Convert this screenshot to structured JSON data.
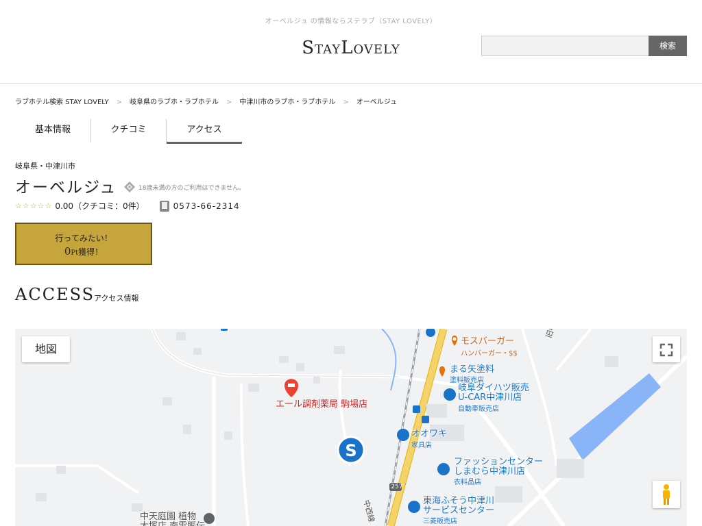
{
  "header": {
    "tagline": "オーベルジュ の情報ならステラブ（STAY LOVELY）",
    "logo": "StayLovely",
    "search_placeholder": "",
    "search_button": "検索"
  },
  "breadcrumb": [
    "ラブホテル検索 STAY LOVELY",
    "岐阜県のラブホ・ラブホテル",
    "中津川市のラブホ・ラブホテル",
    "オーベルジュ"
  ],
  "breadcrumb_separator": ">",
  "tabs": [
    {
      "label": "基本情報",
      "active": false
    },
    {
      "label": "クチコミ",
      "active": false
    },
    {
      "label": "アクセス",
      "active": true
    }
  ],
  "hotel": {
    "area": "岐阜県・中津川市",
    "name": "オーベルジュ",
    "age_notice": "18歳未満の方のご利用はできません。",
    "stars": "☆☆☆☆☆",
    "rating_text": "0.00（クチコミ：0件）",
    "phone": "0573-66-2314"
  },
  "want_button": {
    "line1": "行ってみたい！",
    "points": "0",
    "points_unit": "Pt",
    "line2_suffix": "獲得！"
  },
  "access": {
    "title": "ACCESS",
    "subtitle": "アクセス情報"
  },
  "map": {
    "type_button": "地図",
    "pois": [
      {
        "name": "モスバーガー",
        "sub": "ハンバーガー・$$"
      },
      {
        "name": "まる矢塗料",
        "sub": "塗料販売店"
      },
      {
        "name": "岐阜ダイハツ販売\nU-CAR中津川店",
        "sub": "自動車販売店"
      },
      {
        "name": "エール調剤薬局 駒場店",
        "sub": ""
      },
      {
        "name": "オオワキ",
        "sub": "家具店"
      },
      {
        "name": "ファッションセンター\nしまむら中津川店",
        "sub": "衣料品店"
      },
      {
        "name": "東海ふそう中津川\nサービスセンター",
        "sub": "三菱販売店"
      },
      {
        "name": "中天庭園 植物\n大塚店 南雲賑伝",
        "sub": ""
      }
    ],
    "road_labels": [
      "旧中山道",
      "257",
      "中西線"
    ],
    "colors": {
      "water": "#8ab4f8",
      "main_road": "#f5d36b",
      "poi_orange": "#c5611a",
      "poi_blue": "#1a73c8",
      "poi_red": "#c5221f"
    }
  }
}
